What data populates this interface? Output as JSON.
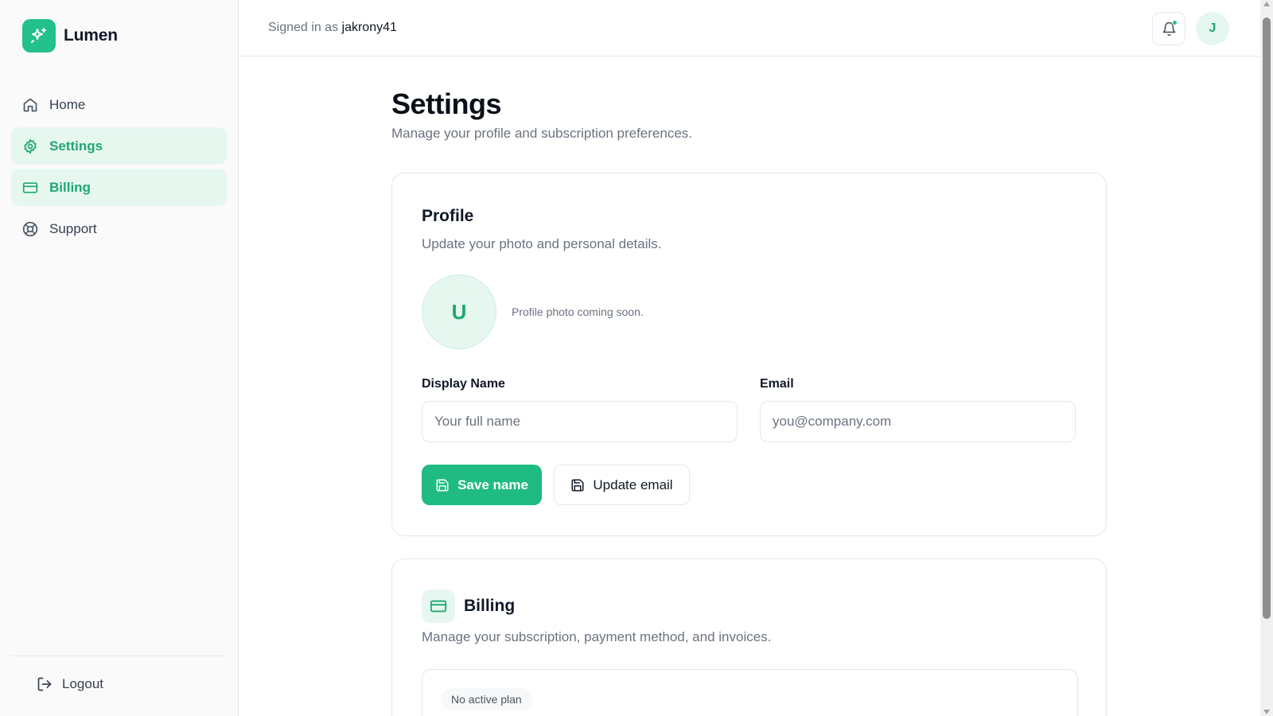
{
  "app": {
    "name": "Lumen",
    "accent": "#22c08a"
  },
  "sidebar": {
    "items": [
      {
        "label": "Home",
        "icon": "home-icon",
        "active": false
      },
      {
        "label": "Settings",
        "icon": "gear-icon",
        "active": true
      },
      {
        "label": "Billing",
        "icon": "credit-card-icon",
        "active": true
      },
      {
        "label": "Support",
        "icon": "lifebuoy-icon",
        "active": false
      }
    ],
    "logout_label": "Logout"
  },
  "header": {
    "signed_in_prefix": "Signed in as",
    "username": "jakrony41",
    "avatar_initial": "J",
    "notification_icon": "bell-icon"
  },
  "page": {
    "title": "Settings",
    "subtitle": "Manage your profile and subscription preferences."
  },
  "profile": {
    "title": "Profile",
    "subtitle": "Update your photo and personal details.",
    "avatar_initial": "U",
    "photo_note": "Profile photo coming soon.",
    "display_name_label": "Display Name",
    "display_name_placeholder": "Your full name",
    "display_name_value": "",
    "email_label": "Email",
    "email_placeholder": "you@company.com",
    "email_value": "",
    "save_name_label": "Save name",
    "update_email_label": "Update email"
  },
  "billing": {
    "title": "Billing",
    "subtitle": "Manage your subscription, payment method, and invoices.",
    "plan_status": "No active plan"
  }
}
